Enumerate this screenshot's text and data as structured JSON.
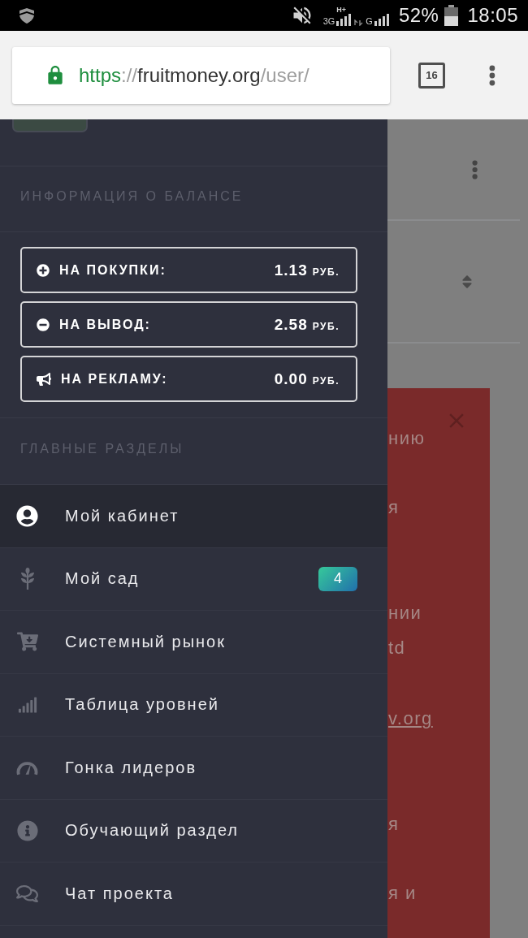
{
  "status_bar": {
    "network_primary": "3G",
    "network_primary_mode": "H+",
    "network_secondary": "G",
    "battery": "52%",
    "time": "18:05"
  },
  "browser": {
    "url": {
      "scheme": "https",
      "separator": "://",
      "host": "fruitmoney.org",
      "path": "/user/"
    },
    "tab_count": "16"
  },
  "drawer": {
    "balance_heading": "ИНФОРМАЦИЯ О БАЛАНСЕ",
    "balances": [
      {
        "kind": "plus",
        "label": "НА ПОКУПКИ:",
        "amount": "1.13",
        "currency": "РУБ."
      },
      {
        "kind": "minus",
        "label": "НА ВЫВОД:",
        "amount": "2.58",
        "currency": "РУБ."
      },
      {
        "kind": "megaphone",
        "label": "НА РЕКЛАМУ:",
        "amount": "0.00",
        "currency": "РУБ."
      }
    ],
    "sections_heading": "ГЛАВНЫЕ РАЗДЕЛЫ",
    "menu": [
      {
        "kind": "user",
        "label": "Мой кабинет",
        "selected": true
      },
      {
        "kind": "wheat",
        "label": "Мой сад",
        "selected": false,
        "badge": "4"
      },
      {
        "kind": "cart",
        "label": "Системный рынок",
        "selected": false
      },
      {
        "kind": "signal",
        "label": "Таблица уровней",
        "selected": false
      },
      {
        "kind": "gauge",
        "label": "Гонка лидеров",
        "selected": false
      },
      {
        "kind": "info",
        "label": "Обучающий раздел",
        "selected": false
      },
      {
        "kind": "chat",
        "label": "Чат проекта",
        "selected": false
      }
    ]
  },
  "background_page": {
    "panel_lines": [
      {
        "kind": "plain",
        "text": "нию"
      },
      {
        "kind": "plain",
        "text": "я"
      },
      {
        "kind": "plain",
        "text": "нии"
      },
      {
        "kind": "plain",
        "text": "td"
      },
      {
        "kind": "link",
        "text": "v.org"
      },
      {
        "kind": "plain",
        "text": "я"
      },
      {
        "kind": "plain",
        "text": "я и"
      }
    ]
  }
}
